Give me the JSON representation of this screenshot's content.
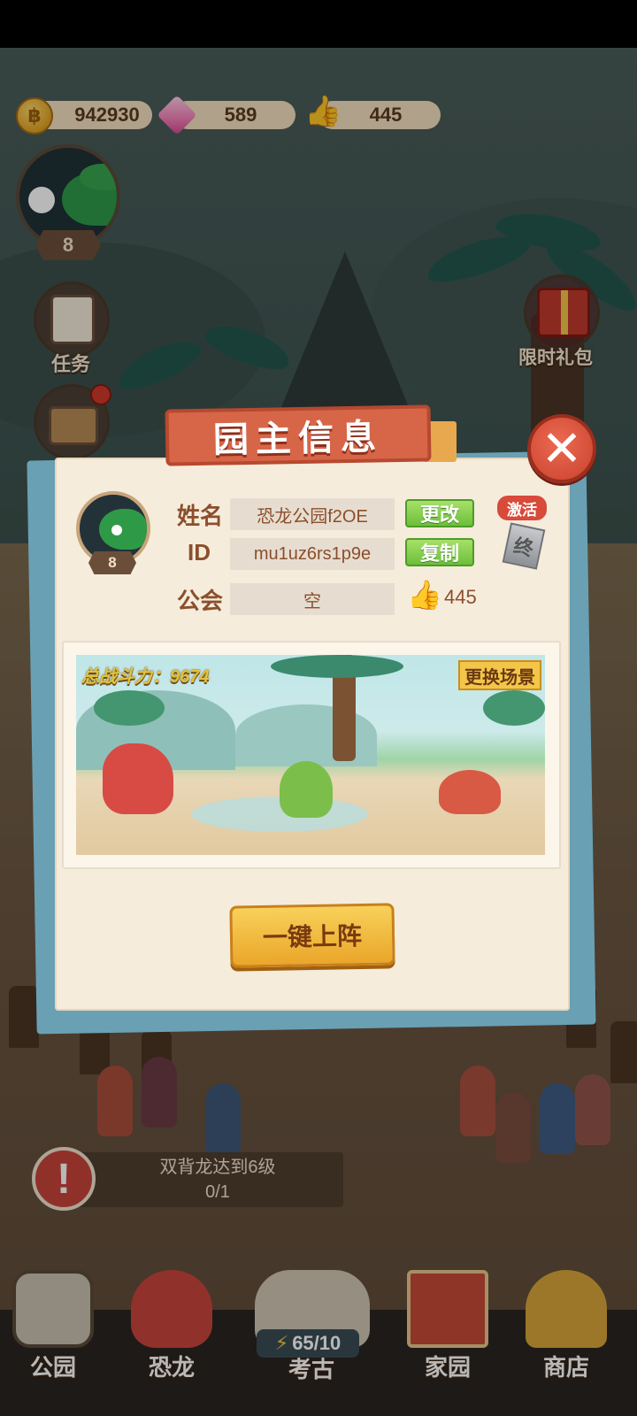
{
  "currencies": {
    "coins": "942930",
    "coin_icon": "coin-icon",
    "gems": "589",
    "likes": "445"
  },
  "player": {
    "level": "8"
  },
  "side_buttons": {
    "tasks": "任务",
    "limited_gift": "限时礼包"
  },
  "modal": {
    "title": "园主信息",
    "close_icon": "close-icon",
    "avatar_level": "8",
    "name_label": "姓名",
    "name_value": "恐龙公园f2OE",
    "rename_button": "更改",
    "id_label": "ID",
    "id_value": "mu1uz6rs1p9e",
    "copy_button": "复制",
    "guild_label": "公会",
    "guild_value": "空",
    "likes": "445",
    "activate_tag": "激活",
    "card_glyph": "终",
    "power_label": "总战斗力：9674",
    "change_scene_button": "更换场景",
    "deploy_button": "一键上阵"
  },
  "quest": {
    "text": "双背龙达到6级",
    "progress": "0/1"
  },
  "nav": {
    "items": [
      {
        "label": "公园",
        "icon": "paw-icon"
      },
      {
        "label": "恐龙",
        "icon": "dinosaur-icon"
      },
      {
        "label": "考古",
        "icon": "fossil-icon"
      },
      {
        "label": "家园",
        "icon": "banner-icon"
      },
      {
        "label": "商店",
        "icon": "shop-icon"
      }
    ],
    "energy": "65/10"
  },
  "colors": {
    "accent_red": "#d76648",
    "button_green": "#6cbf3a",
    "button_gold": "#f3c64a",
    "modal_bg": "#f6ecdc"
  }
}
